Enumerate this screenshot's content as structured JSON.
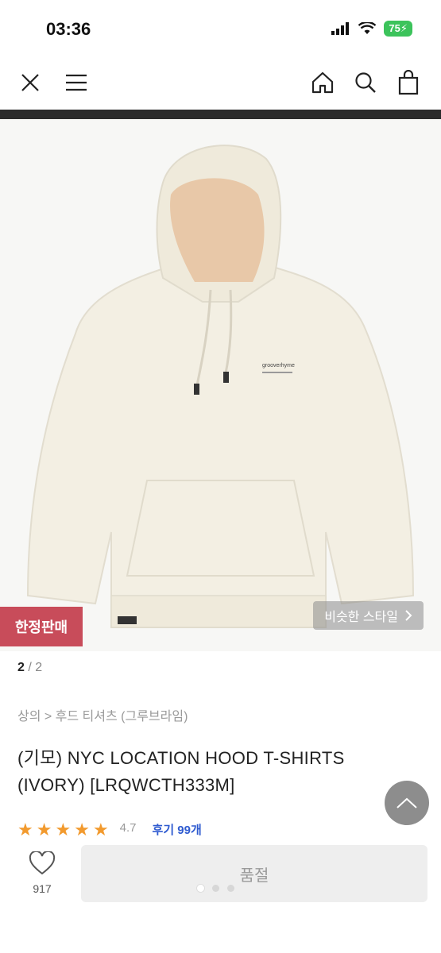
{
  "status": {
    "time": "03:36",
    "battery": "75"
  },
  "nav": {
    "icons": [
      "close-icon",
      "menu-icon",
      "home-icon",
      "search-icon",
      "shopping-bag-icon"
    ]
  },
  "product": {
    "badge": "한정판매",
    "similar_style": "비슷한 스타일",
    "page_current": "2",
    "page_total": "2",
    "breadcrumb": "상의 > 후드 티셔츠 (그루브라임)",
    "title": "(기모) NYC LOCATION HOOD T-SHIRTS (IVORY) [LRQWCTH333M]",
    "rating": "4.7",
    "stars": 5,
    "reviews": "후기 99개",
    "print_text": "grooverhyme"
  },
  "bottom": {
    "like_count": "917",
    "soldout_label": "품절",
    "dots_total": 3,
    "dots_active": 1
  },
  "colors": {
    "badge": "#c84c5a",
    "star": "#f29a2e",
    "review_link": "#2f5bd0",
    "hoodie": "#f3efe3",
    "hood_lining": "#e8c8a8"
  }
}
